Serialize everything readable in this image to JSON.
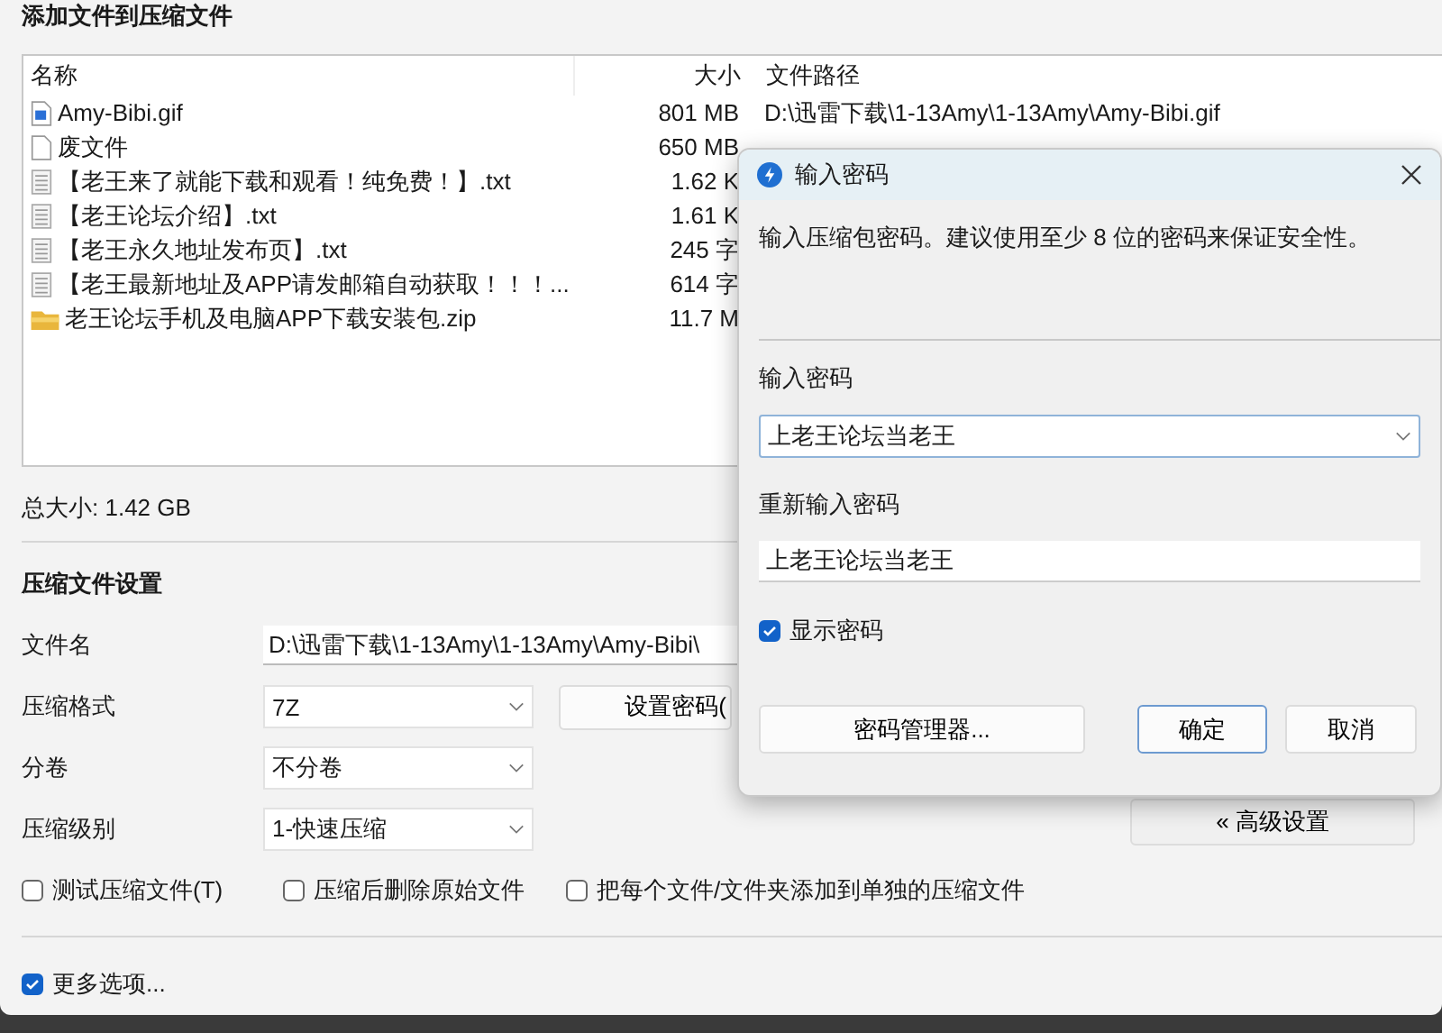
{
  "window": {
    "title": "添加文件到压缩文件"
  },
  "file_list": {
    "columns": [
      "名称",
      "大小",
      "文件路径"
    ],
    "rows": [
      {
        "kind": "image",
        "name": "Amy-Bibi.gif",
        "size": "801 MB",
        "path": "D:\\迅雷下载\\1-13Amy\\1-13Amy\\Amy-Bibi.gif"
      },
      {
        "kind": "blank",
        "name": "废文件",
        "size": "650 MB"
      },
      {
        "kind": "text",
        "name": "【老王来了就能下载和观看！纯免费！】.txt",
        "size": "1.62 K"
      },
      {
        "kind": "text",
        "name": "【老王论坛介绍】.txt",
        "size": "1.61 K"
      },
      {
        "kind": "text",
        "name": "【老王永久地址发布页】.txt",
        "size": "245 字"
      },
      {
        "kind": "text",
        "name": "【老王最新地址及APP请发邮箱自动获取！！！...",
        "size": "614 字"
      },
      {
        "kind": "zip",
        "name": "老王论坛手机及电脑APP下载安装包.zip",
        "size": "11.7 M"
      }
    ]
  },
  "total_size": "总大小: 1.42 GB",
  "settings": {
    "heading": "压缩文件设置",
    "fields": [
      {
        "kind": "text",
        "label": "文件名",
        "value": "D:\\迅雷下载\\1-13Amy\\1-13Amy\\Amy-Bibi\\"
      },
      {
        "kind": "select",
        "label": "压缩格式",
        "value": "7Z"
      },
      {
        "kind": "select",
        "label": "分卷",
        "value": "不分卷"
      },
      {
        "kind": "select",
        "label": "压缩级别",
        "value": "1-快速压缩"
      }
    ],
    "password_button": "设置密码(",
    "advanced_button": "« 高级设置",
    "options": [
      {
        "label": "测试压缩文件(T)",
        "checked": false
      },
      {
        "label": "压缩后删除原始文件",
        "checked": false
      },
      {
        "label": "把每个文件/文件夹添加到单独的压缩文件",
        "checked": false
      }
    ],
    "more_options": {
      "label": "更多选项...",
      "checked": true
    }
  },
  "dialog": {
    "title": "输入密码",
    "message": "输入压缩包密码。建议使用至少 8 位的密码来保证安全性。",
    "password_label": "输入密码",
    "password": "上老王论坛当老王",
    "confirm_label": "重新输入密码",
    "confirm": "上老王论坛当老王",
    "show_password": {
      "label": "显示密码",
      "checked": true
    },
    "buttons": [
      {
        "label": "密码管理器...",
        "default": false
      },
      {
        "label": "确定",
        "default": true
      },
      {
        "label": "取消",
        "default": false
      }
    ]
  }
}
